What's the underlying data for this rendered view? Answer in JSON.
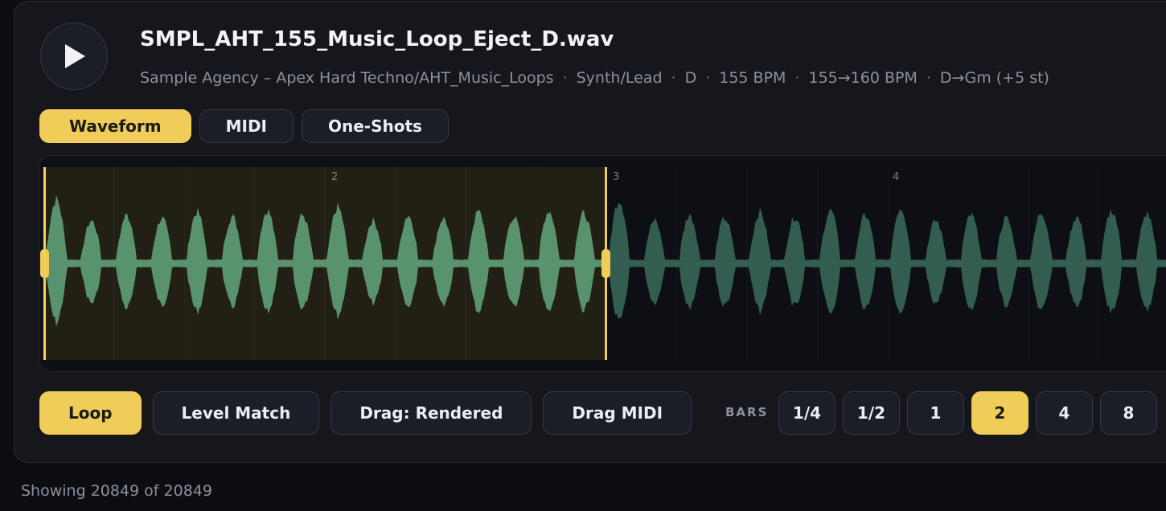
{
  "sample": {
    "filename": "SMPL_AHT_155_Music_Loop_Eject_D.wav",
    "meta": [
      "Sample Agency – Apex Hard Techno/AHT_Music_Loops",
      "Synth/Lead",
      "D",
      "155 BPM",
      "155→160 BPM",
      "D→Gm (+5 st)"
    ],
    "meta_separator": "·"
  },
  "tabs": [
    {
      "label": "Waveform",
      "active": true
    },
    {
      "label": "MIDI",
      "active": false
    },
    {
      "label": "One-Shots",
      "active": false
    }
  ],
  "waveform": {
    "bar_markers": [
      "2",
      "3",
      "4"
    ],
    "loop_region_bars": [
      1,
      3
    ],
    "colors": {
      "loop_bg": "#221f14",
      "wave_in_loop": "#5f9e78",
      "wave_outside": "#3b6b5a",
      "handle": "#f0cd58"
    }
  },
  "controls": [
    {
      "label": "Loop",
      "active": true
    },
    {
      "label": "Level Match",
      "active": false
    },
    {
      "label": "Drag: Rendered",
      "active": false
    },
    {
      "label": "Drag MIDI",
      "active": false
    }
  ],
  "bars": {
    "label": "BARS",
    "options": [
      {
        "label": "1/4",
        "active": false
      },
      {
        "label": "1/2",
        "active": false
      },
      {
        "label": "1",
        "active": false
      },
      {
        "label": "2",
        "active": true
      },
      {
        "label": "4",
        "active": false
      },
      {
        "label": "8",
        "active": false
      }
    ]
  },
  "footer": {
    "status": "Showing 20849 of 20849"
  },
  "theme": {
    "accent": "#f0cd58",
    "panel": "#15171d",
    "background": "#0c0d11"
  }
}
